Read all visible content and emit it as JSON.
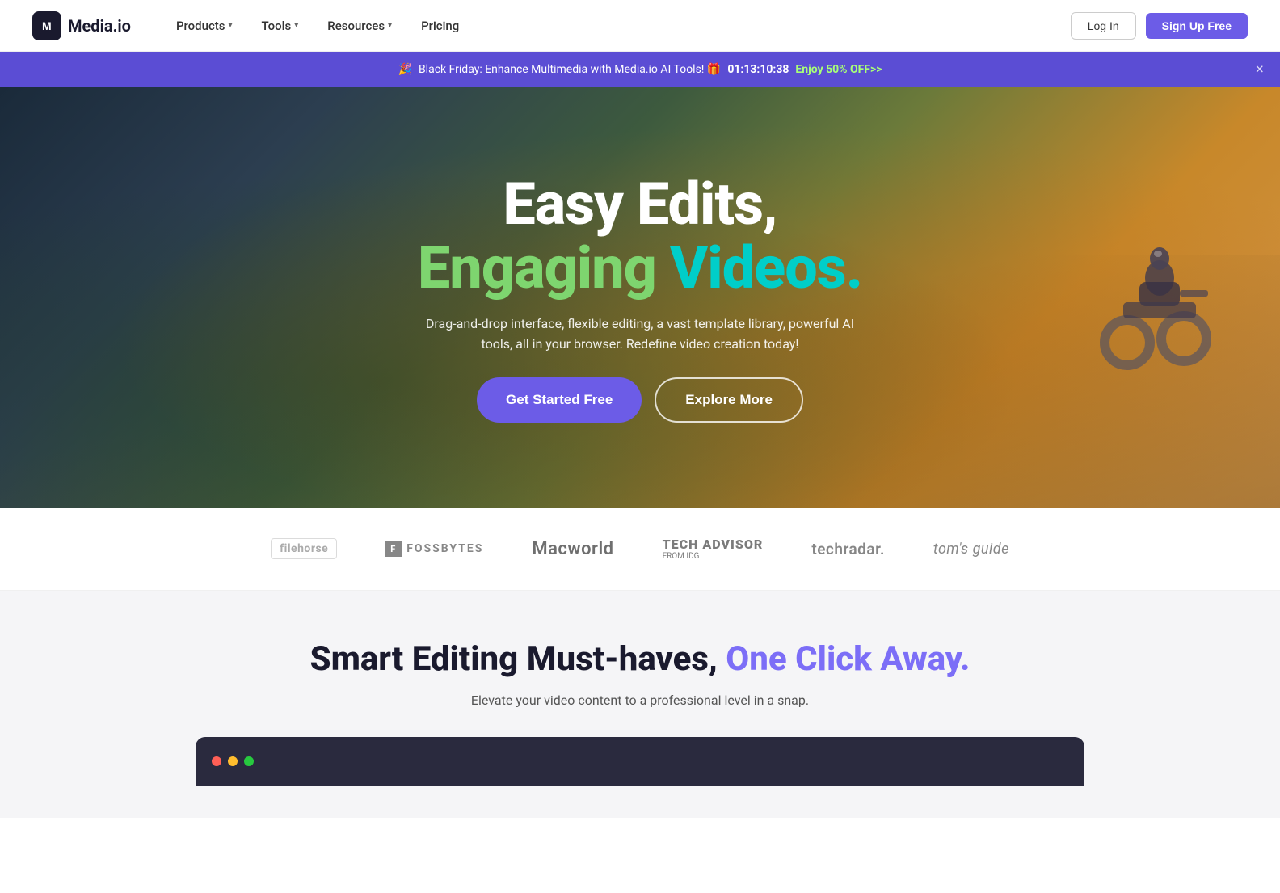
{
  "logo": {
    "icon_text": "M",
    "brand_name": "Media.io"
  },
  "navbar": {
    "products_label": "Products",
    "tools_label": "Tools",
    "resources_label": "Resources",
    "pricing_label": "Pricing",
    "login_label": "Log In",
    "signup_label": "Sign Up Free"
  },
  "promo_banner": {
    "emoji": "🎉",
    "text": "Black Friday: Enhance Multimedia with Media.io AI Tools! 🎁",
    "timer": "01:13:10:38",
    "offer": "Enjoy 50% OFF>>",
    "close": "×"
  },
  "hero": {
    "title_line1": "Easy Edits,",
    "title_line2_part1": "Engaging ",
    "title_line2_part2": "Videos.",
    "subtitle": "Drag-and-drop interface, flexible editing, a vast template library, powerful AI tools, all in your browser. Redefine video creation today!",
    "cta_primary": "Get Started Free",
    "cta_secondary": "Explore More"
  },
  "logos": [
    {
      "name": "filehorse",
      "label": "filehorse",
      "type": "filehorse"
    },
    {
      "name": "fossbytes",
      "label": "FOSSBYTES",
      "type": "fossbytes"
    },
    {
      "name": "macworld",
      "label": "Macworld",
      "type": "macworld"
    },
    {
      "name": "tech-advisor",
      "label": "TECH ADVISOR",
      "sublabel": "FROM IDG",
      "type": "tech-advisor"
    },
    {
      "name": "techradar",
      "label": "techradar.",
      "type": "techradar"
    },
    {
      "name": "toms-guide",
      "label": "tom's guide",
      "type": "toms-guide"
    }
  ],
  "smart_editing": {
    "title_part1": "Smart Editing Must-haves, ",
    "title_part2": "One Click Away.",
    "subtitle": "Elevate your video content to a professional level in a snap."
  },
  "colors": {
    "accent_purple": "#6c5ce7",
    "light_purple": "#7c6ef7",
    "green": "#7ed56f",
    "cyan": "#00cec9",
    "banner_bg": "#5b4dd4",
    "banner_offer": "#a8ff78"
  }
}
